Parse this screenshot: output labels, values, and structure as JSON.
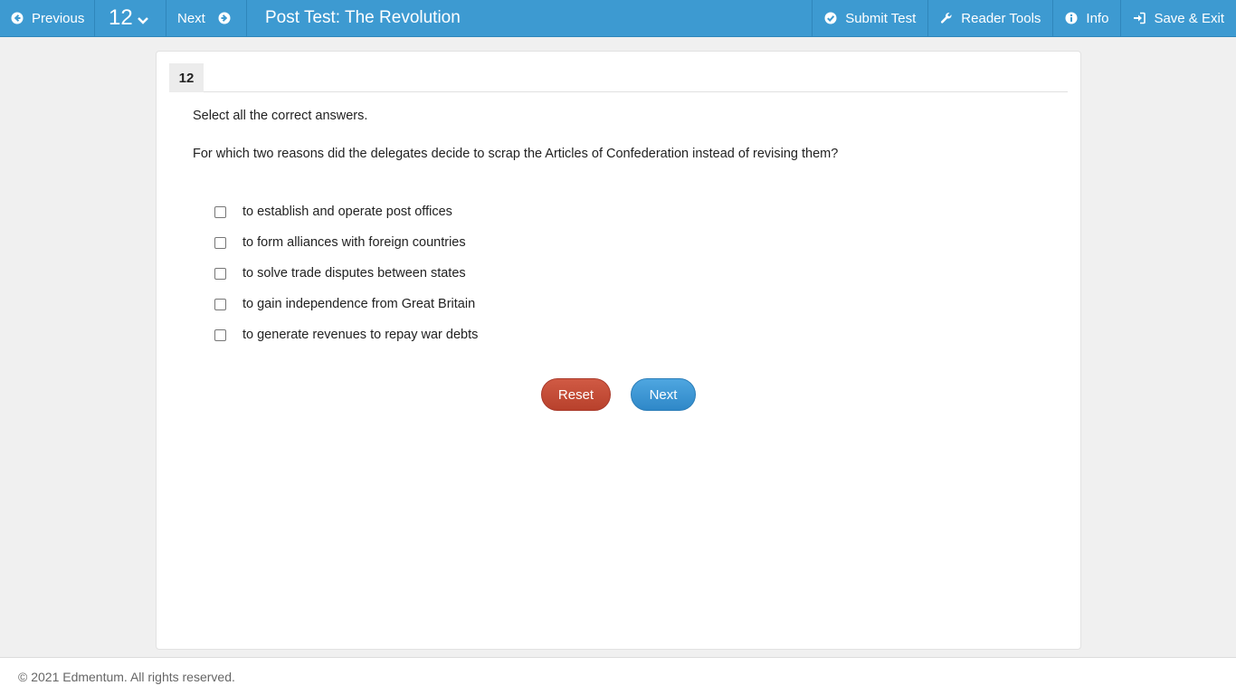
{
  "topbar": {
    "previous_label": "Previous",
    "question_number": "12",
    "next_label": "Next",
    "title": "Post Test: The Revolution",
    "submit_label": "Submit Test",
    "reader_tools_label": "Reader Tools",
    "info_label": "Info",
    "save_exit_label": "Save & Exit"
  },
  "question": {
    "number": "12",
    "instruction": "Select all the correct answers.",
    "prompt": "For which two reasons did the delegates decide to scrap the Articles of Confederation instead of revising them?",
    "options": [
      {
        "label": "to establish and operate post offices",
        "checked": false
      },
      {
        "label": "to form alliances with foreign countries",
        "checked": false
      },
      {
        "label": "to solve trade disputes between states",
        "checked": false
      },
      {
        "label": "to gain independence from Great Britain",
        "checked": false
      },
      {
        "label": "to generate revenues to repay war debts",
        "checked": false
      }
    ]
  },
  "buttons": {
    "reset_label": "Reset",
    "next_label": "Next"
  },
  "footer": {
    "copyright": "© 2021 Edmentum. All rights reserved."
  },
  "colors": {
    "topbar": "#3d9ad1",
    "reset": "#c24d37",
    "next": "#3d97d6"
  }
}
